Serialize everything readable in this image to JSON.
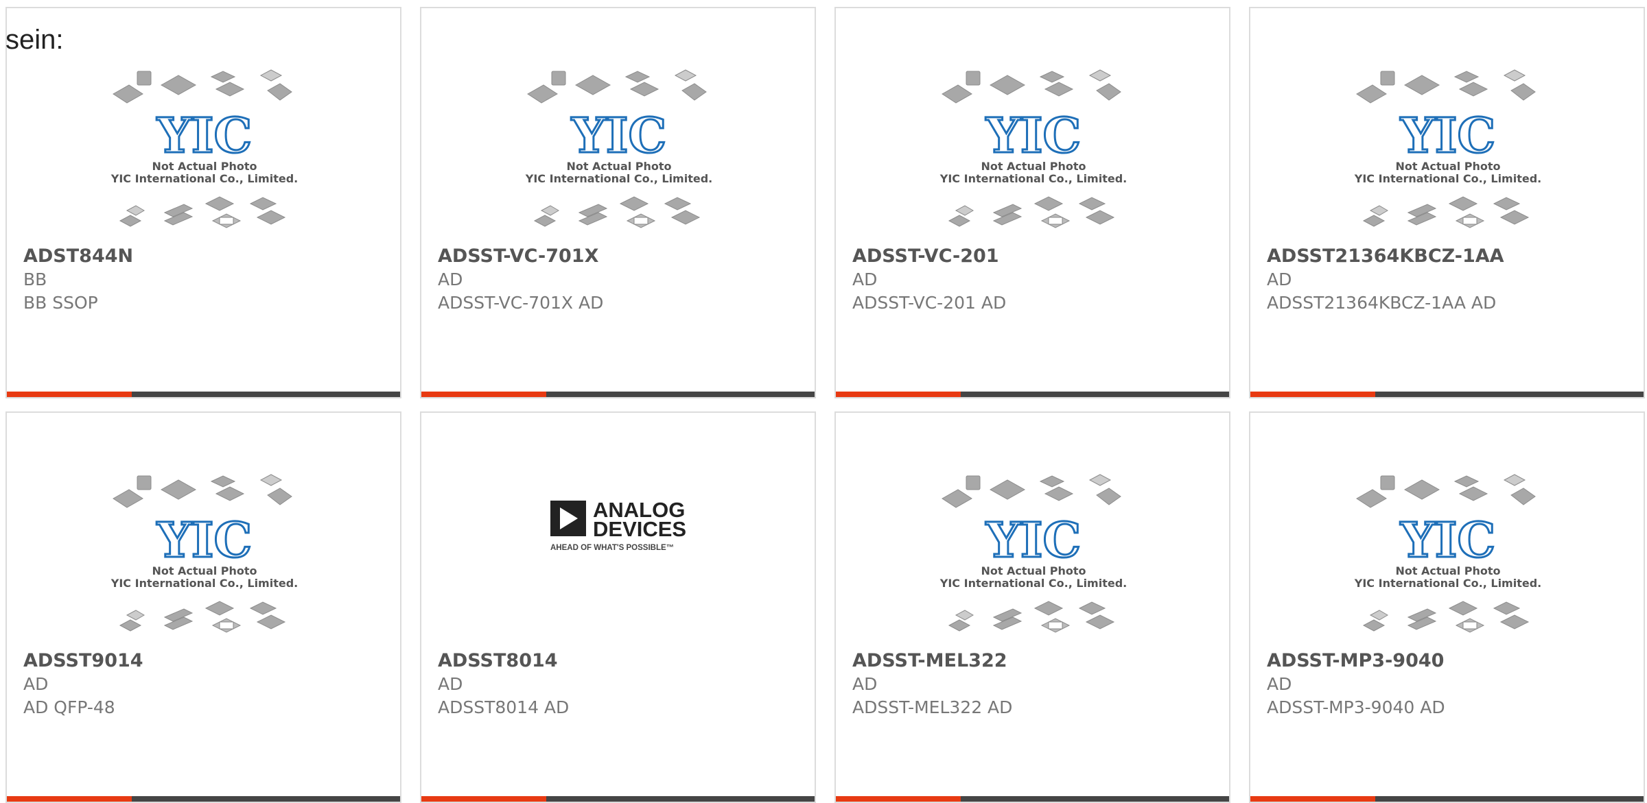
{
  "intro_text": "sein:",
  "placeholder_image": {
    "caption_line1": "Not Actual Photo",
    "caption_line2": "YIC International Co., Limited.",
    "logo_text": "YIC",
    "logo_color": "#1e6fb8"
  },
  "adi_logo": {
    "line1": "ANALOG",
    "line2": "DEVICES",
    "tagline": "AHEAD OF WHAT'S POSSIBLE™"
  },
  "colors": {
    "accent": "#e83a12",
    "bar": "#454545",
    "border": "#dcdcdc"
  },
  "products": [
    {
      "part": "ADST844N",
      "brand": "BB",
      "desc": "BB SSOP",
      "image": "yic-placeholder"
    },
    {
      "part": "ADSST-VC-701X",
      "brand": "AD",
      "desc": "ADSST-VC-701X AD",
      "image": "yic-placeholder"
    },
    {
      "part": "ADSST-VC-201",
      "brand": "AD",
      "desc": "ADSST-VC-201 AD",
      "image": "yic-placeholder"
    },
    {
      "part": "ADSST21364KBCZ-1AA",
      "brand": "AD",
      "desc": "ADSST21364KBCZ-1AA AD",
      "image": "yic-placeholder"
    },
    {
      "part": "ADSST9014",
      "brand": "AD",
      "desc": "AD QFP-48",
      "image": "yic-placeholder"
    },
    {
      "part": "ADSST8014",
      "brand": "AD",
      "desc": "ADSST8014 AD",
      "image": "analog-devices-logo"
    },
    {
      "part": "ADSST-MEL322",
      "brand": "AD",
      "desc": "ADSST-MEL322 AD",
      "image": "yic-placeholder"
    },
    {
      "part": "ADSST-MP3-9040",
      "brand": "AD",
      "desc": "ADSST-MP3-9040 AD",
      "image": "yic-placeholder"
    }
  ]
}
